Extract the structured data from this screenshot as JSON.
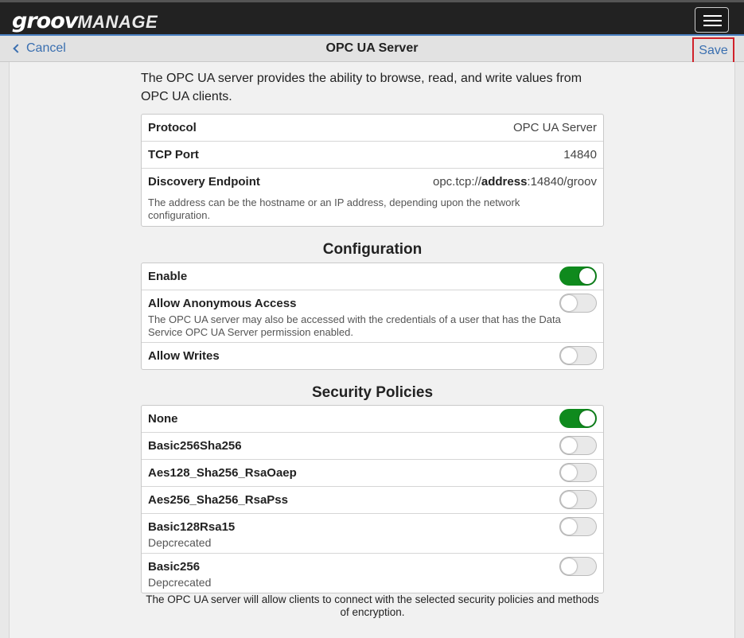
{
  "app": {
    "logo_groov": "groov",
    "logo_manage": "MANAGE"
  },
  "navbar": {
    "cancel_label": "Cancel",
    "title": "OPC UA Server",
    "save_label": "Save"
  },
  "intro": "The OPC UA server provides the ability to browse, read, and write values from OPC UA clients.",
  "info": {
    "protocol_label": "Protocol",
    "protocol_value": "OPC UA Server",
    "port_label": "TCP Port",
    "port_value": "14840",
    "endpoint_label": "Discovery Endpoint",
    "endpoint_prefix": "opc.tcp://",
    "endpoint_bold": "address",
    "endpoint_suffix": ":14840/groov",
    "endpoint_note": "The address can be the hostname or an IP address, depending upon the network configuration."
  },
  "configuration": {
    "title": "Configuration",
    "enable_label": "Enable",
    "anonymous_label": "Allow Anonymous Access",
    "anonymous_note": "The OPC UA server may also be accessed with the credentials of a user that has the Data Service OPC UA Server permission enabled.",
    "writes_label": "Allow Writes",
    "enable_on": true,
    "anonymous_on": false,
    "writes_on": false
  },
  "security": {
    "title": "Security Policies",
    "policies": [
      {
        "label": "None",
        "on": true,
        "sub": ""
      },
      {
        "label": "Basic256Sha256",
        "on": false,
        "sub": ""
      },
      {
        "label": "Aes128_Sha256_RsaOaep",
        "on": false,
        "sub": ""
      },
      {
        "label": "Aes256_Sha256_RsaPss",
        "on": false,
        "sub": ""
      },
      {
        "label": "Basic128Rsa15",
        "on": false,
        "sub": "Depcrecated"
      },
      {
        "label": "Basic256",
        "on": false,
        "sub": "Depcrecated"
      }
    ],
    "footnote": "The OPC UA server will allow clients to connect with the selected security policies and methods of encryption."
  },
  "colors": {
    "accent": "#3a6fb0",
    "toggle_on": "#0f8a1d",
    "highlight": "#d0212a",
    "topbar": "#222222"
  }
}
